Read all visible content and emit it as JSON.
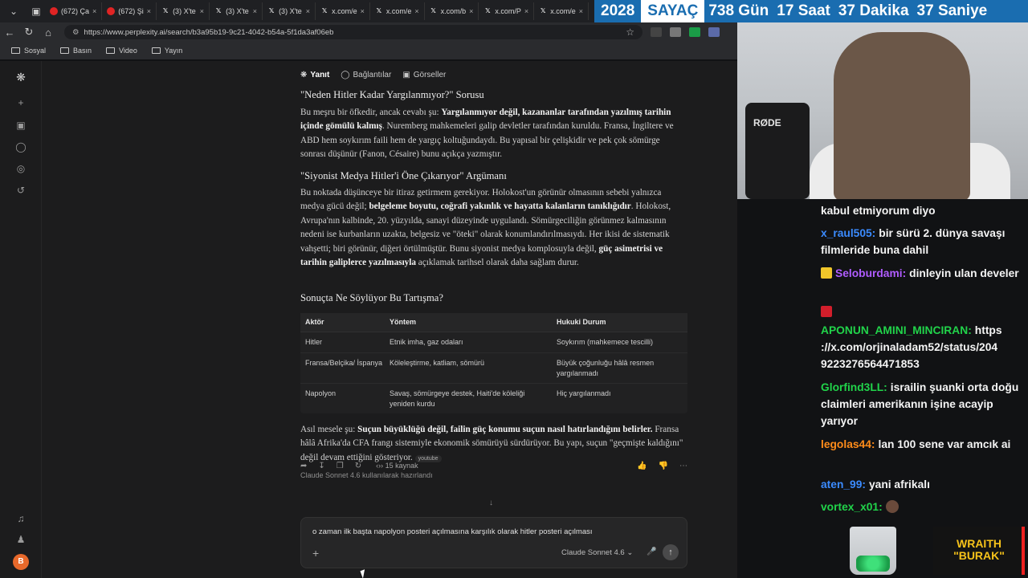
{
  "browser": {
    "tabs": [
      {
        "icon": "youtube-icon",
        "label": "(672) Ça"
      },
      {
        "icon": "youtube-icon",
        "label": "(672) Şi"
      },
      {
        "icon": "x-icon",
        "label": "(3) X'te"
      },
      {
        "icon": "x-icon",
        "label": "(3) X'te"
      },
      {
        "icon": "x-icon",
        "label": "(3) X'te"
      },
      {
        "icon": "x-icon",
        "label": "x.com/e"
      },
      {
        "icon": "x-icon",
        "label": "x.com/e"
      },
      {
        "icon": "x-icon",
        "label": "x.com/b"
      },
      {
        "icon": "x-icon",
        "label": "x.com/P"
      },
      {
        "icon": "x-icon",
        "label": "x.com/e"
      }
    ],
    "url": "https://www.perplexity.ai/search/b3a95b19-9c21-4042-b54a-5f1da3af06eb",
    "bookmarks": [
      "Sosyal",
      "Basın",
      "Video",
      "Yayın"
    ]
  },
  "counter": {
    "year": "2028",
    "label": "SAYAÇ",
    "days": "738 Gün",
    "hours": "17 Saat",
    "minutes": "37 Dakika",
    "seconds": "37 Saniye"
  },
  "subtabs": {
    "answer": "Yanıt",
    "links": "Bağlantılar",
    "images": "Görseller"
  },
  "article": {
    "h1": "\"Neden Hitler Kadar Yargılanmıyor?\" Sorusu",
    "p1_a": "Bu meşru bir öfkedir, ancak cevabı şu: ",
    "p1_b": "Yargılanmıyor değil, kazananlar tarafından yazılmış tarihin içinde gömülü kalmış",
    "p1_c": ". Nuremberg mahkemeleri galip devletler tarafından kuruldu. Fransa, İngiltere ve ABD hem soykırım faili hem de yargıç koltuğundaydı. Bu yapısal bir çelişkidir ve pek çok sömürge sonrası düşünür (Fanon, Césaire) bunu açıkça yazmıştır.",
    "h2": "\"Siyonist Medya Hitler'i Öne Çıkarıyor\" Argümanı",
    "p2_a": "Bu noktada düşünceye bir itiraz getirmem gerekiyor. Holokost'un görünür olmasının sebebi yalnızca medya gücü değil; ",
    "p2_b": "belgeleme boyutu, coğrafi yakınlık ve hayatta kalanların tanıklığıdır",
    "p2_c": ". Holokost, Avrupa'nın kalbinde, 20. yüzyılda, sanayi düzeyinde uygulandı. Sömürgeciliğin görünmez kalmasının nedeni ise kurbanların uzakta, belgesiz ve \"öteki\" olarak konumlandırılmasıydı. Her ikisi de sistematik vahşetti; biri görünür, diğeri örtülmüştür. Bunu siyonist medya komplosuyla değil, ",
    "p2_d": "güç asimetrisi ve tarihin galiplerce yazılmasıyla",
    "p2_e": " açıklamak tarihsel olarak daha sağlam durur.",
    "h3": "Sonuçta Ne Söylüyor Bu Tartışma?",
    "p3_a": "Asıl mesele şu: ",
    "p3_b": "Suçun büyüklüğü değil, failin güç konumu suçun nasıl hatırlandığını belirler.",
    "p3_c": " Fransa hâlâ Afrika'da CFA frangı sistemiyle ekonomik sömürüyü sürdürüyor. Bu yapı, suçun \"geçmişte kaldığını\" değil devam ettiğini gösteriyor.",
    "p3_source": "youtube",
    "made_with": "Claude Sonnet 4.6 kullanılarak hazırlandı"
  },
  "table": {
    "headers": [
      "Aktör",
      "Yöntem",
      "Hukuki Durum"
    ],
    "rows": [
      [
        "Hitler",
        "Etnik imha, gaz odaları",
        "Soykırım (mahkemece tescilli)"
      ],
      [
        "Fransa/Belçika/ İspanya",
        "Köleleştirme, katliam, sömürü",
        "Büyük çoğunluğu hâlâ resmen yargılanmadı"
      ],
      [
        "Napolyon",
        "Savaş, sömürgeye destek, Haiti'de köleliği yeniden kurdu",
        "Hiç yargılanmadı"
      ]
    ]
  },
  "actions": {
    "sources": "15 kaynak"
  },
  "composer": {
    "query": "o zaman ilk başta napolyon posteri açılmasına karşılık olarak hitler posteri açılması",
    "model": "Claude Sonnet 4.6"
  },
  "stream": {
    "mic_brand": "RØDE",
    "overlay_brand": "WRAITH \"BURAK\""
  },
  "chat": [
    {
      "user": "",
      "user_color": "#ffffff",
      "text": "kabul etmiyorum diyo"
    },
    {
      "user": "x_raul505:",
      "user_color": "#3b8bff",
      "text": "bir sürü 2. dünya savaşı filmleride buna dahil"
    },
    {
      "user": "Seloburdami:",
      "user_color": "#b05cff",
      "text": "dinleyin ulan develer",
      "badge": "yellow"
    },
    {
      "user": "APONUN_AMINI_MINCIRAN:",
      "user_color": "#21d34a",
      "text": "https ://x.com/orjinaladam52/status/204 9223276564471853",
      "badge": "red"
    },
    {
      "user": "Glorfind3LL:",
      "user_color": "#21d34a",
      "text": "israilin şuanki orta doğu claimleri amerikanın işine acayip yarıyor"
    },
    {
      "user": "legolas44:",
      "user_color": "#ff8c1a",
      "text": "lan 100 sene var amcık ai"
    },
    {
      "user": "aten_99:",
      "user_color": "#3b8bff",
      "text": "yani afrikalı"
    },
    {
      "user": "vortex_x01:",
      "user_color": "#21d34a",
      "text": ""
    }
  ]
}
